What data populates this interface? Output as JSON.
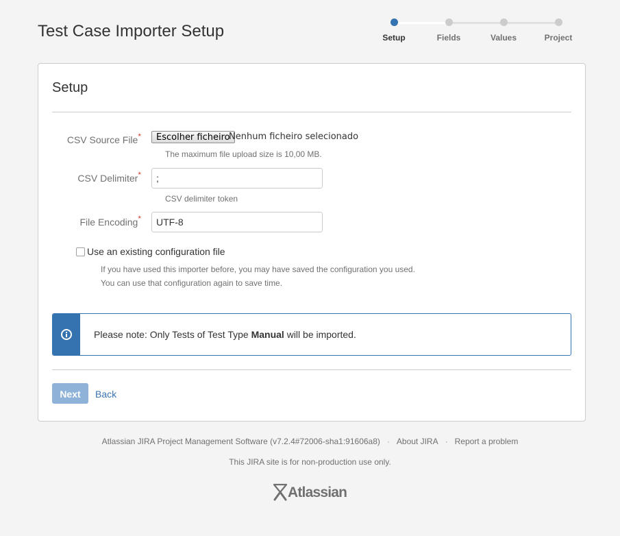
{
  "header": {
    "title": "Test Case Importer Setup"
  },
  "progress": {
    "steps": [
      {
        "label": "Setup",
        "state": "current"
      },
      {
        "label": "Fields",
        "state": "todo"
      },
      {
        "label": "Values",
        "state": "todo"
      },
      {
        "label": "Project",
        "state": "todo"
      }
    ],
    "current_color": "#3572b0"
  },
  "form": {
    "title": "Setup",
    "required_marker": "*",
    "csv_file": {
      "label": "CSV Source File",
      "button": "Escolher ficheiro",
      "status": "Nenhum ficheiro selecionado",
      "description": "The maximum file upload size is 10,00 MB."
    },
    "delimiter": {
      "label": "CSV Delimiter",
      "value": ";",
      "description": "CSV delimiter token"
    },
    "encoding": {
      "label": "File Encoding",
      "value": "UTF-8"
    },
    "config_checkbox": {
      "label": "Use an existing configuration file",
      "checked": false,
      "description_line1": "If you have used this importer before, you may have saved the configuration you used.",
      "description_line2": "You can use that configuration again to save time."
    },
    "note": {
      "prefix": "Please note: Only Tests of Test Type ",
      "emphasis": "Manual",
      "suffix": " will be imported.",
      "icon": "info-icon"
    },
    "buttons": {
      "next": "Next",
      "back": "Back"
    }
  },
  "footer": {
    "software": "Atlassian JIRA Project Management Software (v7.2.4#72006-sha1:91606a8)",
    "separator": "·",
    "about": "About JIRA",
    "report": "Report a problem",
    "note": "This JIRA site is for non-production use only.",
    "logo": "Atlassian"
  }
}
